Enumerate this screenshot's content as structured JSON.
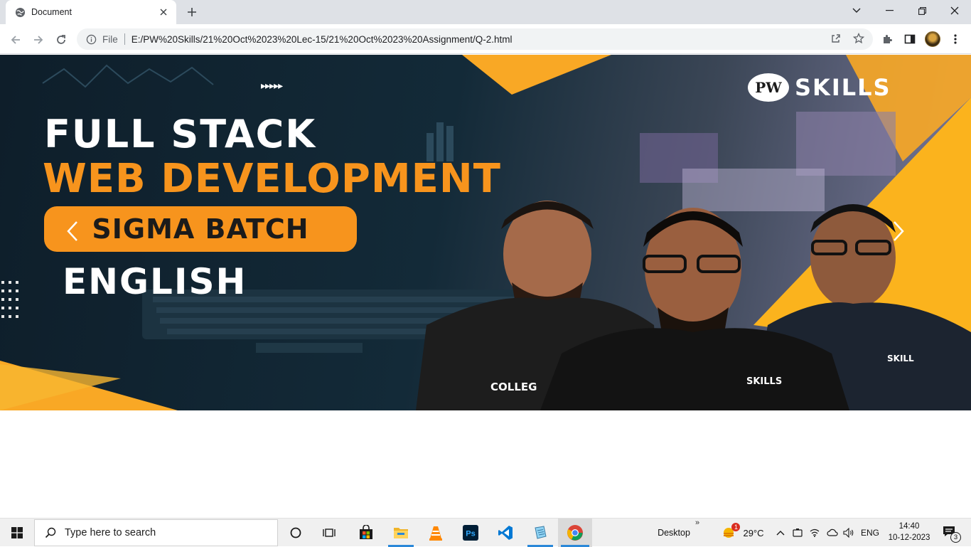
{
  "tab": {
    "title": "Document",
    "favicon": "globe-icon",
    "close_icon": "close-icon"
  },
  "window": {
    "controls": [
      "chevron-down-icon",
      "minimize-icon",
      "restore-icon",
      "close-icon"
    ]
  },
  "toolbar": {
    "scheme": "File",
    "url": "E:/PW%20Skills/21%20Oct%2023%20Lec-15/21%20Oct%2023%20Assignment/Q-2.html",
    "icons": [
      "back-icon",
      "forward-icon",
      "reload-icon",
      "info-icon",
      "share-icon",
      "star-icon",
      "extensions-icon",
      "sidepanel-icon",
      "profile-avatar",
      "menu-icon"
    ]
  },
  "banner": {
    "logo_mark": "PW",
    "logo_word": "SKILLS",
    "arrow_mark": "▸▸▸▸▸",
    "line1": "FULL STACK",
    "line2": "WEB DEVELOPMENT",
    "pill": "SIGMA BATCH",
    "line3": "ENGLISH",
    "shirt_left": "COLLEG",
    "shirt_center": "SKILLS",
    "shirt_right": "SKILL",
    "colors": {
      "accent": "#f7941d",
      "dark_bg": "#0e1e2a"
    }
  },
  "taskbar": {
    "search_placeholder": "Type here to search",
    "desktop_label": "Desktop",
    "desktop_chevron": "»",
    "weather_temp": "29°C",
    "weather_badge": "1",
    "language": "ENG",
    "time": "14:40",
    "date": "10-12-2023",
    "notification_count": "3",
    "apps": [
      "windows-start-icon",
      "cortana-icon",
      "task-view-icon",
      "store-icon",
      "file-explorer-icon",
      "vlc-icon",
      "photoshop-icon",
      "vscode-icon",
      "notepad-icon",
      "chrome-icon"
    ]
  }
}
